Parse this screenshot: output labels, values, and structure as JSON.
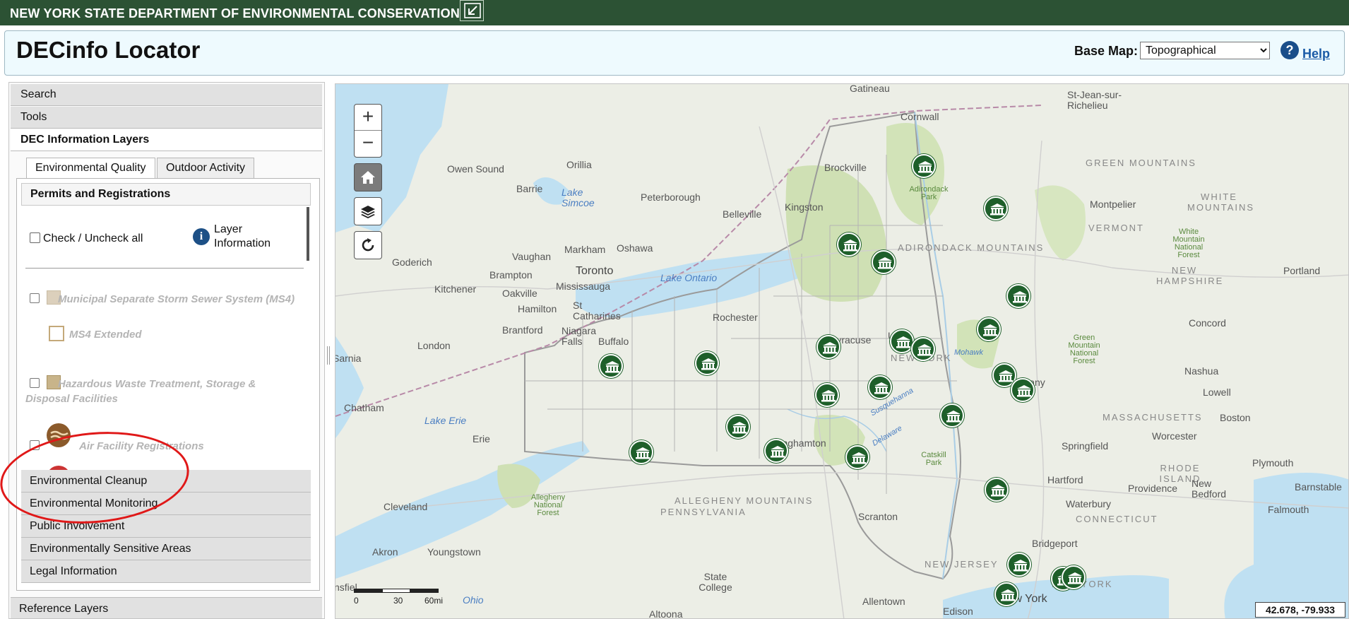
{
  "agency_bar": {
    "title": "NEW YORK STATE DEPARTMENT OF ENVIRONMENTAL CONSERVATION",
    "collapse_icon": "collapse-arrow-icon"
  },
  "header": {
    "app_title": "DECinfo Locator",
    "basemap_label": "Base Map:",
    "basemap_selected": "Topographical",
    "help_icon": "?",
    "help_label": "Help"
  },
  "left_panel": {
    "accordions": [
      "Search",
      "Tools",
      "DEC Information Layers"
    ],
    "tabs": [
      "Environmental Quality",
      "Outdoor Activity"
    ],
    "active_tab": "Environmental Quality",
    "permits": {
      "header": "Permits and Registrations",
      "check_all_label": "Check / Uncheck all",
      "info_icon": "i",
      "layer_info_label": "Layer Information",
      "layers": [
        {
          "label": "Municipal Separate Storm Sewer System (MS4)",
          "swatch_color": "#dcd0bc"
        },
        {
          "label": "MS4 Extended",
          "swatch_color": "#c4a97a"
        },
        {
          "label": "Hazardous Waste Treatment, Storage & Disposal Facilities",
          "swatch_color": "#c8b48a"
        },
        {
          "label": "Air Facility Registrations",
          "icon": "air-facility-icon"
        }
      ]
    },
    "sub_accordions": [
      "Environmental Cleanup",
      "Environmental Monitoring",
      "Public Involvement",
      "Environmentally Sensitive Areas",
      "Legal Information"
    ],
    "reference_layers": "Reference Layers"
  },
  "map": {
    "controls": {
      "zoom_in": "+",
      "zoom_out": "−"
    },
    "labels": {
      "gatineau": "Gatineau",
      "cornwall": "Cornwall",
      "stjean": "St-Jean-sur-Richelieu",
      "orillia": "Orillia",
      "owen_sound": "Owen Sound",
      "barrie": "Barrie",
      "lake_simcoe": "Lake Simcoe",
      "peterborough": "Peterborough",
      "belleville": "Belleville",
      "kingston": "Kingston",
      "brockville": "Brockville",
      "green_mountains": "GREEN MOUNTAINS",
      "montpelier": "Montpelier",
      "white_mountains": "WHITE MOUNTAINS",
      "vermont": "VERMONT",
      "wm_forest": "White Mountain National Forest",
      "new_hampshire": "NEW HAMPSHIRE",
      "portland": "Portland",
      "adirondack_mtns": "ADIRONDACK MOUNTAINS",
      "adirondack_park": "Adirondack Park",
      "goderich": "Goderich",
      "vaughan": "Vaughan",
      "markham": "Markham",
      "oshawa": "Oshawa",
      "toronto": "Toronto",
      "brampton": "Brampton",
      "mississauga": "Mississauga",
      "oakville": "Oakville",
      "kitchener": "Kitchener",
      "lake_ontario": "Lake Ontario",
      "hamilton": "Hamilton",
      "st_catharines": "St Catharines",
      "rochester": "Rochester",
      "brantford": "Brantford",
      "niagara_falls": "Niagara Falls",
      "buffalo": "Buffalo",
      "london": "London",
      "sarnia": "Sarnia",
      "syracuse": "Syracuse",
      "utica": "Utica",
      "new_york_state": "NEW YORK",
      "mohawk": "Mohawk",
      "albany": "Albany",
      "green_mtn_forest": "Green Mountain National Forest",
      "concord": "Concord",
      "nashua": "Nashua",
      "lowell": "Lowell",
      "chatham": "Chatham",
      "lake_erie": "Lake Erie",
      "erie": "Erie",
      "binghamton": "Binghamton",
      "susquehanna": "Susquehanna",
      "delaware": "Delaware",
      "catskill": "Catskill Park",
      "massachusetts": "MASSACHUSETTS",
      "boston": "Boston",
      "worcester": "Worcester",
      "springfield": "Springfield",
      "rhode_island": "RHODE ISLAND",
      "plymouth": "Plymouth",
      "hartford": "Hartford",
      "providence": "Providence",
      "new_bedford": "New Bedford",
      "barnstable": "Barnstable",
      "allegheny_forest": "Allegheny National Forest",
      "allegheny_mtns": "ALLEGHENY MOUNTAINS",
      "pennsylvania": "PENNSYLVANIA",
      "cleveland": "Cleveland",
      "waterbury": "Waterbury",
      "falmouth": "Falmouth",
      "connecticut": "CONNECTICUT",
      "scranton": "Scranton",
      "bridgeport": "Bridgeport",
      "akron": "Akron",
      "youngstown": "Youngstown",
      "new_jersey": "NEW JERSEY",
      "state_college": "State College",
      "allentown": "Allentown",
      "edison": "Edison",
      "new_york_city": "New York",
      "ohio": "Ohio",
      "altoona": "Altoona",
      "mansfield": "nsfiel",
      "long_island": "NEW YORK"
    },
    "scale_labels": [
      "0",
      "30",
      "60mi"
    ],
    "coordinates": "42.678, -79.933",
    "facility_icon": "facility-building-icon",
    "facility_count": 29
  }
}
